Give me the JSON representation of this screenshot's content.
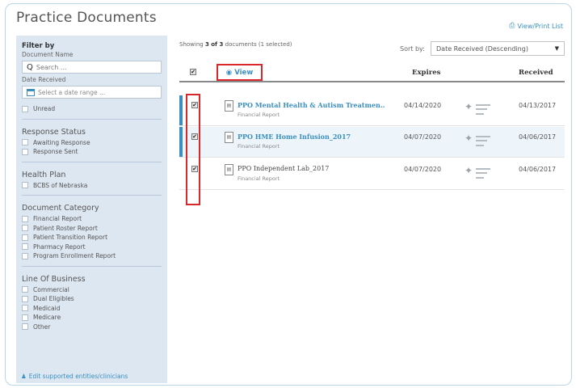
{
  "page": {
    "title": "Practice Documents",
    "view_print": "View/Print List"
  },
  "sidebar": {
    "filter_by": "Filter by",
    "document_name_label": "Document Name",
    "search_placeholder": "Search ...",
    "date_received_label": "Date Received",
    "date_placeholder": "Select a date range ...",
    "unread": "Unread",
    "sections": [
      {
        "title": "Response Status",
        "items": [
          "Awaiting Response",
          "Response Sent"
        ]
      },
      {
        "title": "Health Plan",
        "items": [
          "BCBS of Nebraska"
        ]
      },
      {
        "title": "Document Category",
        "items": [
          "Financial Report",
          "Patient Roster Report",
          "Patient Transition Report",
          "Pharmacy Report",
          "Program Enrollment Report"
        ]
      },
      {
        "title": "Line Of Business",
        "items": [
          "Commercial",
          "Dual Eligibles",
          "Medicaid",
          "Medicare",
          "Other"
        ]
      }
    ],
    "edit_link": "Edit supported entities/clinicians"
  },
  "main": {
    "showing_prefix": "Showing ",
    "showing_count": "3 of 3",
    "showing_suffix": " documents (1 selected)",
    "sort_label": "Sort by:",
    "sort_value": "Date Received (Descending)",
    "columns": {
      "view": "View",
      "expires": "Expires",
      "received": "Received"
    },
    "rows": [
      {
        "title": "PPO Mental Health & Autism Treatmen..",
        "subtitle": "Financial Report",
        "expires": "04/14/2020",
        "received": "04/13/2017",
        "checked": true,
        "unread": true
      },
      {
        "title": "PPO HME Home Infusion_2017",
        "subtitle": "Financial Report",
        "expires": "04/07/2020",
        "received": "04/06/2017",
        "checked": true,
        "unread": true
      },
      {
        "title": "PPO Independent Lab_2017",
        "subtitle": "Financial Report",
        "expires": "04/07/2020",
        "received": "04/06/2017",
        "checked": true,
        "unread": false
      }
    ]
  },
  "icons": {
    "print": "print-icon",
    "eye": "eye-icon",
    "search": "search-icon",
    "calendar": "calendar-icon",
    "user": "user-icon",
    "document": "document-icon",
    "logo": "nebraska-logo-icon"
  },
  "colors": {
    "accent": "#3a8fc0",
    "highlight_box": "#d9272e",
    "sidebar_bg": "#dde7f1",
    "selected_row_bg": "#eef5fa"
  }
}
